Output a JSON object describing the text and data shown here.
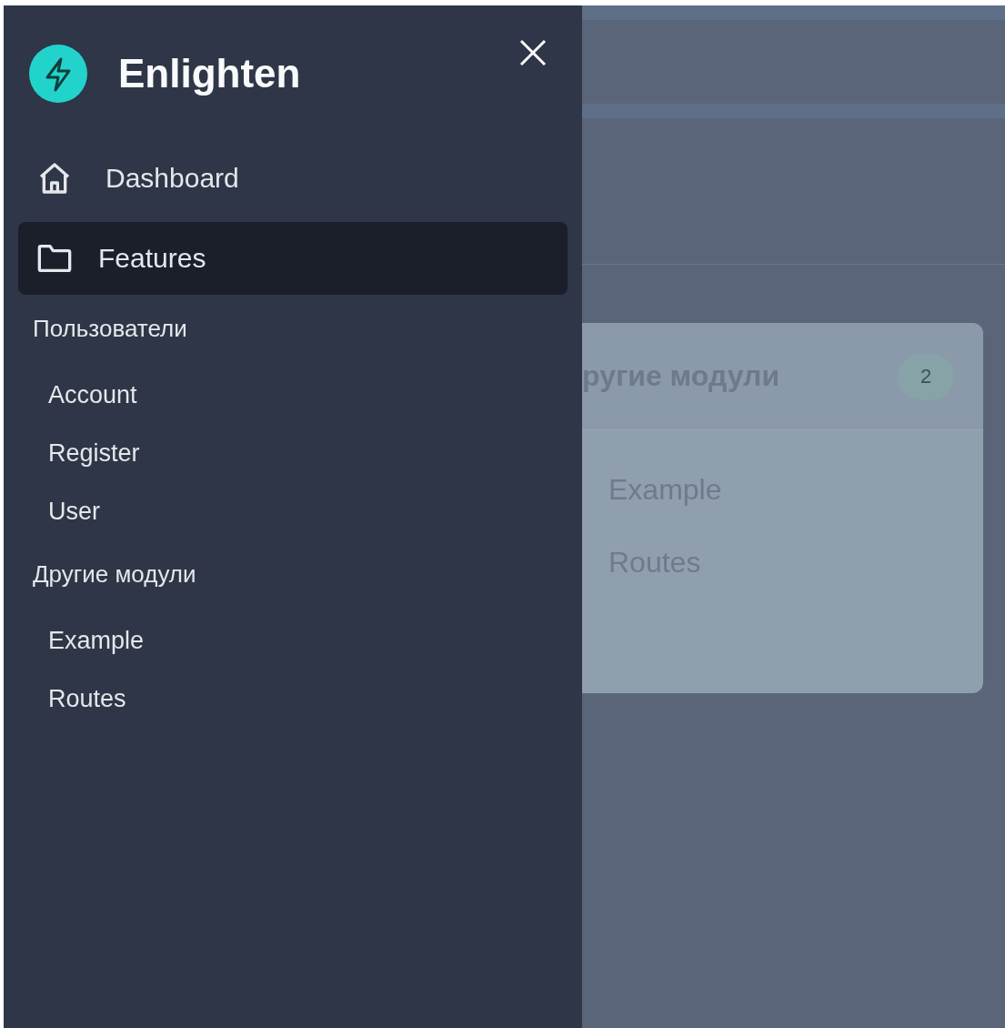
{
  "drawer": {
    "title": "Enlighten",
    "nav": [
      {
        "label": "Dashboard",
        "kind": "home",
        "selected": false
      },
      {
        "label": "Features",
        "kind": "folder",
        "selected": true
      }
    ],
    "sections": [
      {
        "title": "Пользователи",
        "items": [
          "Account",
          "Register",
          "User"
        ]
      },
      {
        "title": "Другие модули",
        "items": [
          "Example",
          "Routes"
        ]
      }
    ]
  },
  "background": {
    "card": {
      "title": "ругие модули",
      "count": "2",
      "items": [
        "Example",
        "Routes"
      ]
    }
  }
}
